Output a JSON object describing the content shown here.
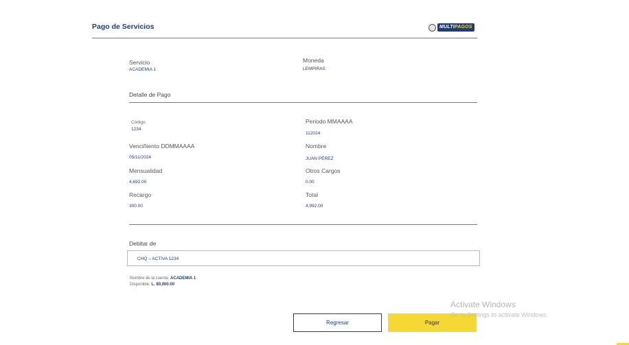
{
  "page": {
    "title": "Pago de Servicios"
  },
  "logo": {
    "mark_a": "MULTI",
    "mark_b": "PAGOS"
  },
  "service": {
    "label": "Servicio",
    "value": "ACADEMIA 1",
    "currency_label": "Moneda",
    "currency_value": "LEMPIRAS"
  },
  "detail": {
    "heading": "Detalle de Pago",
    "codigo_label": "Código",
    "codigo_value": "1234",
    "periodo_label": "Periodo MMAAAA",
    "periodo_value": "112024",
    "vencimiento_label": "Venciñiento DDMMAAAA",
    "vencimiento_value": "05/11/2024",
    "nombre_label": "Nombre",
    "nombre_value": "JUAN PÉREZ",
    "mensualidad_label": "Mensualidad",
    "mensualidad_value": "4,692.00",
    "otros_label": "Otros Cargos",
    "otros_value": "0.00",
    "recargo_label": "Recargo",
    "recargo_value": "300.00",
    "total_label": "Total",
    "total_value": "4,992.00"
  },
  "debit": {
    "label": "Debitar de",
    "selected": "CHQ – ACTIVA 1234",
    "account_name_label": "Nombre de la cuenta: ",
    "account_name_value": "ACADEMIA 1",
    "available_label": "Disponible: ",
    "available_value": "L. 80,000.00"
  },
  "actions": {
    "back_label": "Regresar",
    "pay_label": "Pagar"
  },
  "watermark": {
    "line1": "Activate Windows",
    "line2": "Go to Settings to activate Windows."
  },
  "colors": {
    "brand_blue": "#1d3d7a",
    "accent_yellow": "#f6d834"
  }
}
